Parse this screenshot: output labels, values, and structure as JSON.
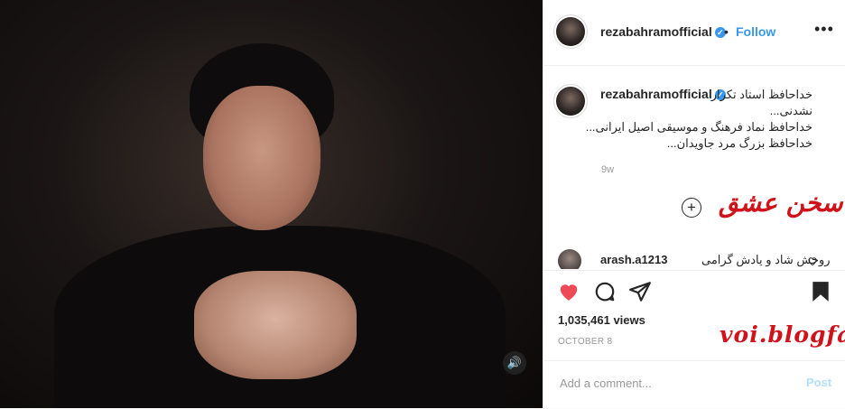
{
  "header": {
    "username": "rezabahramofficial",
    "verified_icon": "verified-badge-icon",
    "separator": "•",
    "follow_label": "Follow",
    "more_icon": "more-options-icon",
    "more_label": "•••"
  },
  "caption": {
    "username": "rezabahramofficial",
    "lines": [
      "خداحافظ استاد تکرار",
      "نشدنی...",
      "خداحافظ نماد فرهنگ و موسیقی اصیل ایرانی...",
      "خداحافظ بزرگ مرد جاویدان..."
    ],
    "time": "9w"
  },
  "watermarks": {
    "persian": "صدای سخن عشق",
    "latin": "voi.blogfa"
  },
  "comment": {
    "username": "arash.a1213",
    "text": "روحش شاد و یادش گرامی",
    "like_icon": "heart-outline-icon"
  },
  "actions": {
    "like_icon": "heart-filled-icon",
    "like_color": "#ed4956",
    "comment_icon": "comment-icon",
    "share_icon": "share-icon",
    "save_icon": "bookmark-filled-icon",
    "views": "1,035,461 views",
    "date": "OCTOBER 8"
  },
  "add_comment": {
    "placeholder": "Add a comment...",
    "post_label": "Post"
  },
  "media": {
    "sound_icon": "speaker-icon",
    "load_more_icon": "plus-circle-icon"
  }
}
